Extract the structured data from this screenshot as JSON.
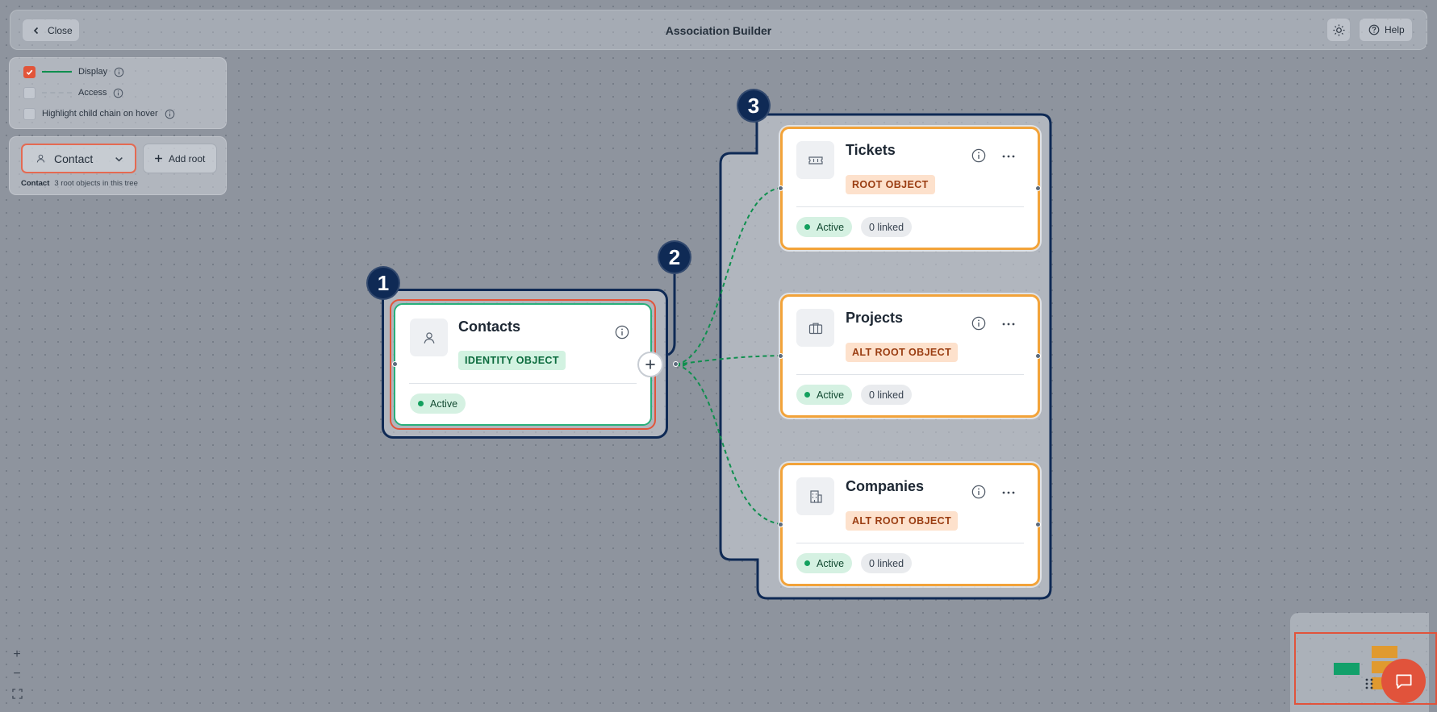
{
  "topbar": {
    "close_label": "Close",
    "title": "Association Builder",
    "help_label": "Help"
  },
  "legend": {
    "display_label": "Display",
    "display_checked": true,
    "access_label": "Access",
    "access_checked": false,
    "highlight_label": "Highlight child chain on hover",
    "highlight_checked": false,
    "display_color": "#0f8f4e",
    "check_color": "#e2553a"
  },
  "root_panel": {
    "selected_root": "Contact",
    "add_root_label": "Add root",
    "info_root": "Contact",
    "info_text": "3 root objects in this tree"
  },
  "canvas": {
    "steps": [
      "1",
      "2",
      "3"
    ],
    "source_card": {
      "title": "Contacts",
      "tag": "IDENTITY OBJECT",
      "status": "Active",
      "icon": "user-icon"
    },
    "target_cards": [
      {
        "title": "Tickets",
        "tag": "ROOT OBJECT",
        "status": "Active",
        "linked": "0 linked",
        "icon": "ticket-icon"
      },
      {
        "title": "Projects",
        "tag": "ALT ROOT OBJECT",
        "status": "Active",
        "linked": "0 linked",
        "icon": "briefcase-icon"
      },
      {
        "title": "Companies",
        "tag": "ALT ROOT OBJECT",
        "status": "Active",
        "linked": "0 linked",
        "icon": "building-icon"
      }
    ],
    "connector_color": "#0f8f4e",
    "group_border_color": "#0f2a55",
    "card_highlight_color": "#f2a33a"
  },
  "zoom_controls": {
    "zoom_in": "+",
    "zoom_out": "−"
  }
}
